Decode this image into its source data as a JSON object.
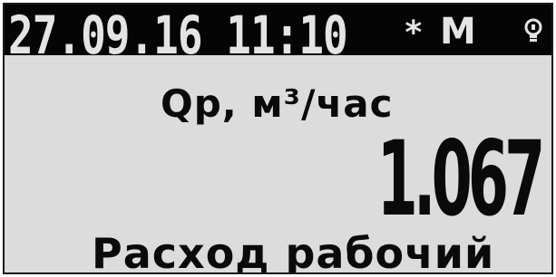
{
  "status_bar": {
    "datetime": "27.09.16 11:10",
    "asterisk": "*",
    "mode": "M",
    "indicator_icon": "bulb-icon"
  },
  "main": {
    "parameter_label": "Qр, м³/час",
    "value": "1.067",
    "description": "Расход рабочий"
  },
  "colors": {
    "status_bar_bg": "#050505",
    "status_bar_text": "#e4e4e4",
    "screen_bg": "#dcdcdc",
    "text": "#0a0a0a"
  }
}
